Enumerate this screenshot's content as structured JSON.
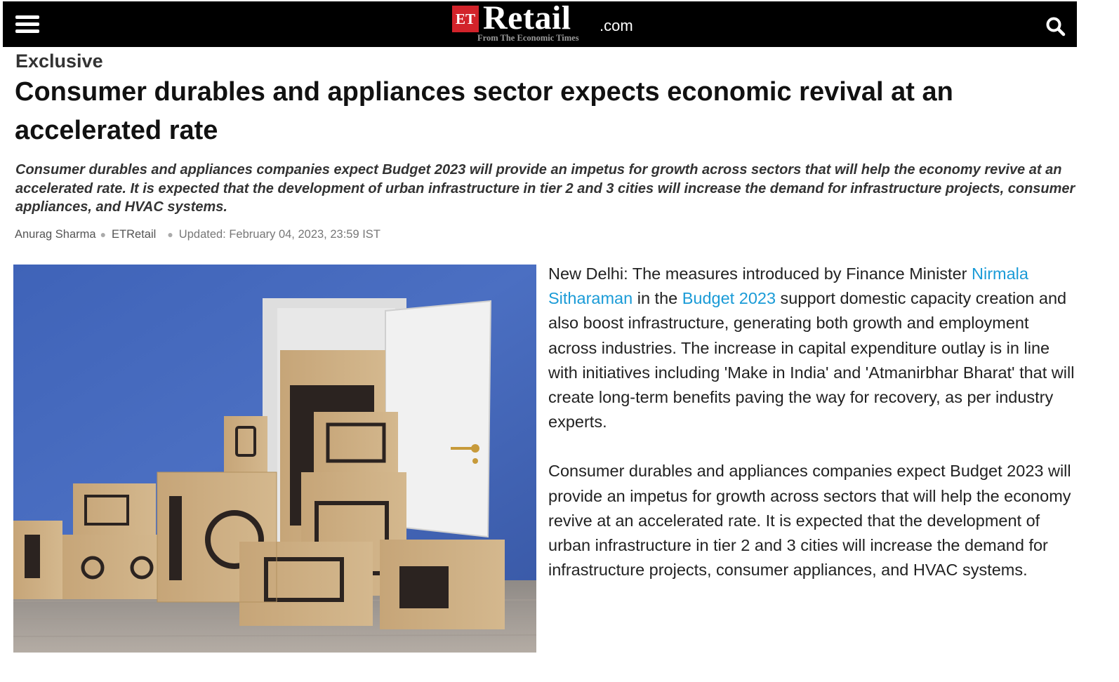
{
  "header": {
    "logo_et": "ET",
    "logo_retail": "Retail",
    "logo_com": ".com",
    "logo_tagline": "From The Economic Times"
  },
  "article": {
    "kicker": "Exclusive",
    "headline": "Consumer durables and appliances sector expects economic revival at an accelerated rate",
    "synopsis": "Consumer durables and appliances companies expect Budget 2023 will provide an impetus for growth across sectors that will help the economy revive at an accelerated rate. It is expected that the development of urban infrastructure in tier 2 and 3 cities will increase the demand for infrastructure projects, consumer appliances, and HVAC systems.",
    "author": "Anurag Sharma",
    "source": "ETRetail",
    "updated": "Updated: February 04, 2023, 23:59 IST",
    "para1": {
      "before_link1": "New Delhi: The measures introduced by Finance Minister ",
      "link1": "Nirmala Sitharaman",
      "between_links": " in the ",
      "link2": "Budget 2023",
      "after_links": " support domestic capacity creation and also boost infrastructure, generating both growth and employment across industries. The increase in capital expenditure outlay is in line with initiatives including 'Make in India' and 'Atmanirbhar Bharat' that will create long-term benefits paving the way for recovery, as per industry experts."
    },
    "para2": "Consumer durables and appliances companies expect Budget 2023 will provide an impetus for growth across sectors that will help the economy revive at an accelerated rate. It is expected that the development of urban infrastructure in tier 2 and 3 cities will increase the demand for infrastructure projects, consumer appliances, and HVAC systems."
  },
  "colors": {
    "header_bg": "#000000",
    "brand_red": "#d2232a",
    "link": "#1a9bd7"
  },
  "icons": {
    "menu": "hamburger-menu-icon",
    "search": "search-icon"
  }
}
